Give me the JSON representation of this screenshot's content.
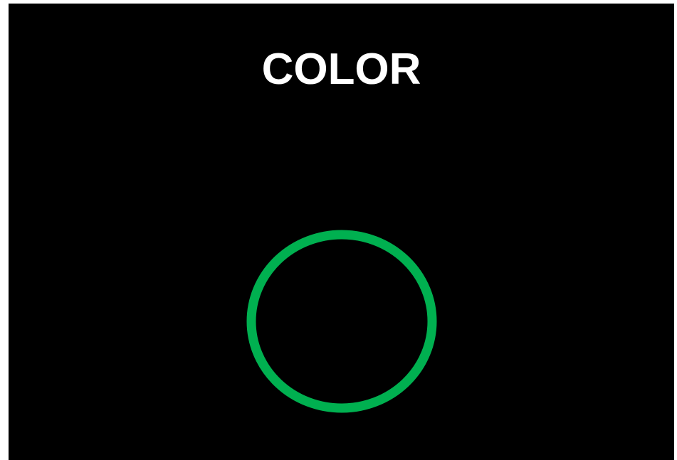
{
  "slide": {
    "title": "COLOR",
    "background_color": "#000000",
    "title_color": "#ffffff"
  },
  "shape": {
    "kind": "circle-outline",
    "stroke_color": "#00b050",
    "fill": "none"
  }
}
